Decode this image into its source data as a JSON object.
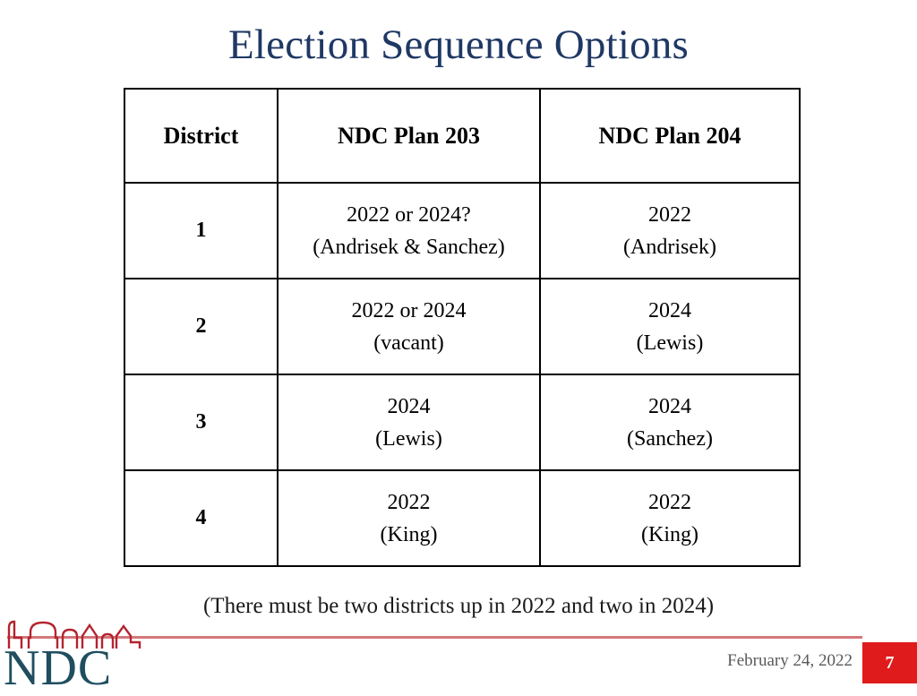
{
  "slide": {
    "title": "Election Sequence Options",
    "title_color": "#1F3864",
    "caption": "(There must be two districts up in 2022 and two in 2024)"
  },
  "table": {
    "headers": [
      "District",
      "NDC Plan 203",
      "NDC Plan 204"
    ],
    "rows": [
      {
        "district": "1",
        "plan203_line1": "2022 or 2024?",
        "plan203_line2": "(Andrisek & Sanchez)",
        "plan204_line1": "2022",
        "plan204_line2": "(Andrisek)"
      },
      {
        "district": "2",
        "plan203_line1": "2022 or 2024",
        "plan203_line2": "(vacant)",
        "plan204_line1": "2024",
        "plan204_line2": "(Lewis)"
      },
      {
        "district": "3",
        "plan203_line1": "2024",
        "plan203_line2": "(Lewis)",
        "plan204_line1": "2024",
        "plan204_line2": "(Sanchez)"
      },
      {
        "district": "4",
        "plan203_line1": "2022",
        "plan203_line2": "(King)",
        "plan204_line1": "2022",
        "plan204_line2": "(King)"
      }
    ]
  },
  "footer": {
    "date": "February 24, 2022",
    "page_number": "7",
    "badge_color": "#E01B1B",
    "rule_color": "#d4797c"
  },
  "logo": {
    "wordmark": "NDC",
    "wordmark_color": "#1F4E5F",
    "skyline_color": "#B32430",
    "skyline_icon": "city-skyline-icon"
  }
}
